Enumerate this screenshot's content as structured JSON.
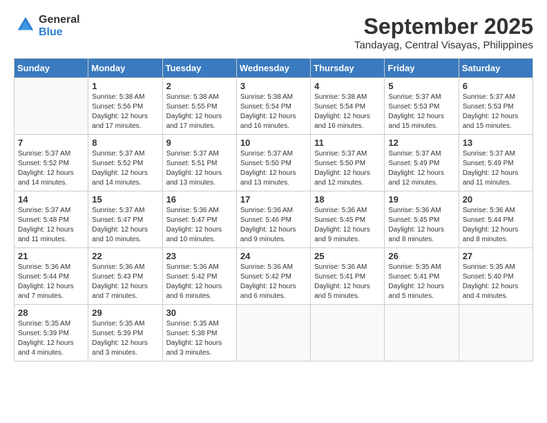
{
  "header": {
    "logo_line1": "General",
    "logo_line2": "Blue",
    "month_title": "September 2025",
    "location": "Tandayag, Central Visayas, Philippines"
  },
  "days_of_week": [
    "Sunday",
    "Monday",
    "Tuesday",
    "Wednesday",
    "Thursday",
    "Friday",
    "Saturday"
  ],
  "weeks": [
    [
      {
        "day": "",
        "info": ""
      },
      {
        "day": "1",
        "info": "Sunrise: 5:38 AM\nSunset: 5:56 PM\nDaylight: 12 hours\nand 17 minutes."
      },
      {
        "day": "2",
        "info": "Sunrise: 5:38 AM\nSunset: 5:55 PM\nDaylight: 12 hours\nand 17 minutes."
      },
      {
        "day": "3",
        "info": "Sunrise: 5:38 AM\nSunset: 5:54 PM\nDaylight: 12 hours\nand 16 minutes."
      },
      {
        "day": "4",
        "info": "Sunrise: 5:38 AM\nSunset: 5:54 PM\nDaylight: 12 hours\nand 16 minutes."
      },
      {
        "day": "5",
        "info": "Sunrise: 5:37 AM\nSunset: 5:53 PM\nDaylight: 12 hours\nand 15 minutes."
      },
      {
        "day": "6",
        "info": "Sunrise: 5:37 AM\nSunset: 5:53 PM\nDaylight: 12 hours\nand 15 minutes."
      }
    ],
    [
      {
        "day": "7",
        "info": "Sunrise: 5:37 AM\nSunset: 5:52 PM\nDaylight: 12 hours\nand 14 minutes."
      },
      {
        "day": "8",
        "info": "Sunrise: 5:37 AM\nSunset: 5:52 PM\nDaylight: 12 hours\nand 14 minutes."
      },
      {
        "day": "9",
        "info": "Sunrise: 5:37 AM\nSunset: 5:51 PM\nDaylight: 12 hours\nand 13 minutes."
      },
      {
        "day": "10",
        "info": "Sunrise: 5:37 AM\nSunset: 5:50 PM\nDaylight: 12 hours\nand 13 minutes."
      },
      {
        "day": "11",
        "info": "Sunrise: 5:37 AM\nSunset: 5:50 PM\nDaylight: 12 hours\nand 12 minutes."
      },
      {
        "day": "12",
        "info": "Sunrise: 5:37 AM\nSunset: 5:49 PM\nDaylight: 12 hours\nand 12 minutes."
      },
      {
        "day": "13",
        "info": "Sunrise: 5:37 AM\nSunset: 5:49 PM\nDaylight: 12 hours\nand 11 minutes."
      }
    ],
    [
      {
        "day": "14",
        "info": "Sunrise: 5:37 AM\nSunset: 5:48 PM\nDaylight: 12 hours\nand 11 minutes."
      },
      {
        "day": "15",
        "info": "Sunrise: 5:37 AM\nSunset: 5:47 PM\nDaylight: 12 hours\nand 10 minutes."
      },
      {
        "day": "16",
        "info": "Sunrise: 5:36 AM\nSunset: 5:47 PM\nDaylight: 12 hours\nand 10 minutes."
      },
      {
        "day": "17",
        "info": "Sunrise: 5:36 AM\nSunset: 5:46 PM\nDaylight: 12 hours\nand 9 minutes."
      },
      {
        "day": "18",
        "info": "Sunrise: 5:36 AM\nSunset: 5:45 PM\nDaylight: 12 hours\nand 9 minutes."
      },
      {
        "day": "19",
        "info": "Sunrise: 5:36 AM\nSunset: 5:45 PM\nDaylight: 12 hours\nand 8 minutes."
      },
      {
        "day": "20",
        "info": "Sunrise: 5:36 AM\nSunset: 5:44 PM\nDaylight: 12 hours\nand 8 minutes."
      }
    ],
    [
      {
        "day": "21",
        "info": "Sunrise: 5:36 AM\nSunset: 5:44 PM\nDaylight: 12 hours\nand 7 minutes."
      },
      {
        "day": "22",
        "info": "Sunrise: 5:36 AM\nSunset: 5:43 PM\nDaylight: 12 hours\nand 7 minutes."
      },
      {
        "day": "23",
        "info": "Sunrise: 5:36 AM\nSunset: 5:42 PM\nDaylight: 12 hours\nand 6 minutes."
      },
      {
        "day": "24",
        "info": "Sunrise: 5:36 AM\nSunset: 5:42 PM\nDaylight: 12 hours\nand 6 minutes."
      },
      {
        "day": "25",
        "info": "Sunrise: 5:36 AM\nSunset: 5:41 PM\nDaylight: 12 hours\nand 5 minutes."
      },
      {
        "day": "26",
        "info": "Sunrise: 5:35 AM\nSunset: 5:41 PM\nDaylight: 12 hours\nand 5 minutes."
      },
      {
        "day": "27",
        "info": "Sunrise: 5:35 AM\nSunset: 5:40 PM\nDaylight: 12 hours\nand 4 minutes."
      }
    ],
    [
      {
        "day": "28",
        "info": "Sunrise: 5:35 AM\nSunset: 5:39 PM\nDaylight: 12 hours\nand 4 minutes."
      },
      {
        "day": "29",
        "info": "Sunrise: 5:35 AM\nSunset: 5:39 PM\nDaylight: 12 hours\nand 3 minutes."
      },
      {
        "day": "30",
        "info": "Sunrise: 5:35 AM\nSunset: 5:38 PM\nDaylight: 12 hours\nand 3 minutes."
      },
      {
        "day": "",
        "info": ""
      },
      {
        "day": "",
        "info": ""
      },
      {
        "day": "",
        "info": ""
      },
      {
        "day": "",
        "info": ""
      }
    ]
  ]
}
